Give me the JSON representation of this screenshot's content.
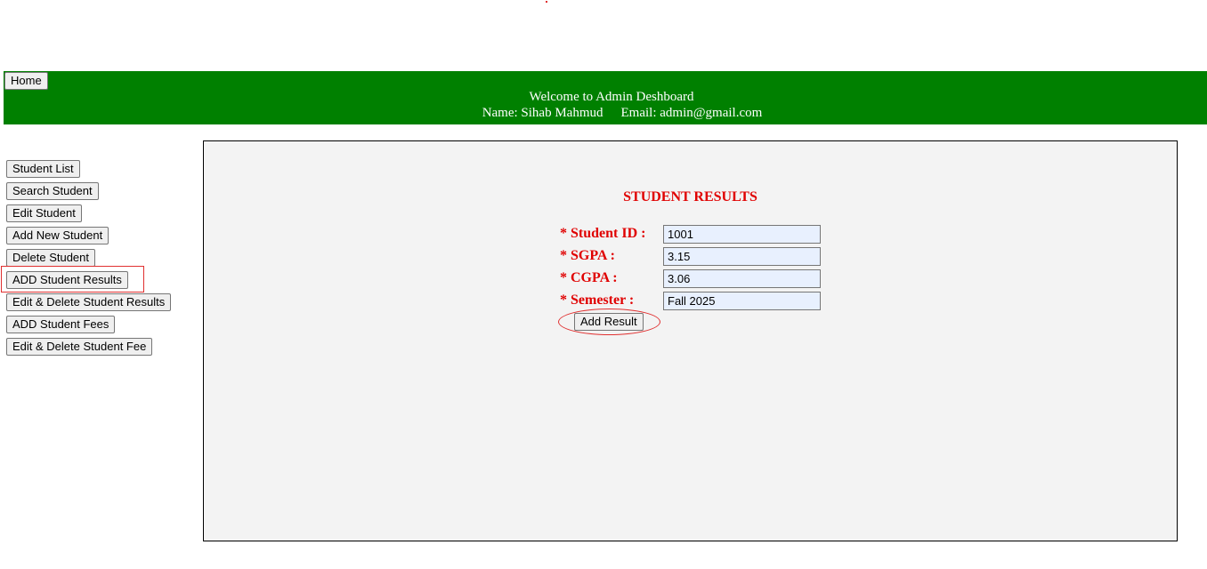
{
  "header": {
    "home_label": "Home",
    "welcome": "Welcome to Admin Deshboard",
    "name_text": "Name: Sihab Mahmud",
    "email_text": "Email: admin@gmail.com"
  },
  "sidebar": {
    "items": [
      {
        "label": "Student List"
      },
      {
        "label": "Search Student"
      },
      {
        "label": "Edit Student"
      },
      {
        "label": "Add New Student"
      },
      {
        "label": "Delete Student"
      },
      {
        "label": "ADD Student Results"
      },
      {
        "label": "Edit & Delete Student Results"
      },
      {
        "label": "ADD Student Fees"
      },
      {
        "label": "Edit & Delete Student Fee"
      }
    ]
  },
  "form": {
    "title": "STUDENT RESULTS",
    "fields": [
      {
        "label": "* Student ID :",
        "value": "1001"
      },
      {
        "label": "* SGPA :",
        "value": "3.15"
      },
      {
        "label": "* CGPA :",
        "value": "3.06"
      },
      {
        "label": "* Semester :",
        "value": "Fall 2025"
      }
    ],
    "submit_label": "Add Result"
  },
  "colors": {
    "header_bg": "#008000",
    "accent_red": "#e00000",
    "panel_bg": "#f3f3f3",
    "input_bg": "#e8f0fe",
    "annotation": "#e03030"
  }
}
